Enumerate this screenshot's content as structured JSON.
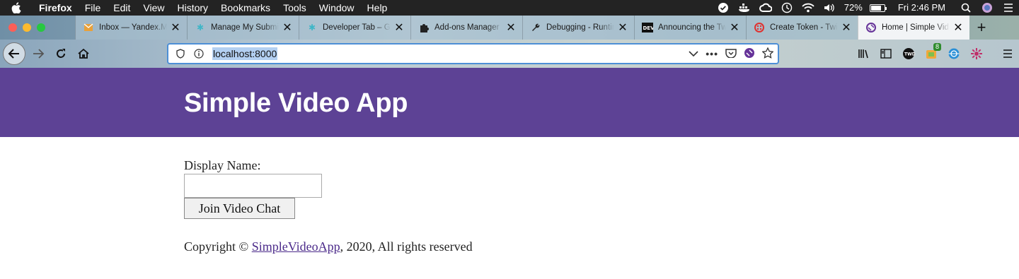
{
  "os_menubar": {
    "app_name": "Firefox",
    "menus": [
      "File",
      "Edit",
      "View",
      "History",
      "Bookmarks",
      "Tools",
      "Window",
      "Help"
    ],
    "battery_percent": "72%",
    "clock": "Fri 2:46 PM"
  },
  "tabs": [
    {
      "title": "Inbox — Yandex.Mail",
      "icon": "mail-icon",
      "color": "#e8a13a"
    },
    {
      "title": "Manage My Submissions",
      "icon": "puzzle-glyph-icon",
      "color": "#3fb6c7"
    },
    {
      "title": "Developer Tab – GitHub",
      "icon": "puzzle-glyph-icon",
      "color": "#3fb6c7"
    },
    {
      "title": "Add-ons Manager",
      "icon": "puzzle-icon",
      "color": "#222222"
    },
    {
      "title": "Debugging - Runtime",
      "icon": "wrench-icon",
      "color": "#222222"
    },
    {
      "title": "Announcing the Twilio",
      "icon": "dev-icon",
      "color": "#111111"
    },
    {
      "title": "Create Token - Twilio",
      "icon": "twilio-icon",
      "color": "#e0312f"
    },
    {
      "title": "Home | Simple Video App",
      "icon": "gatsby-icon",
      "color": "#663399",
      "active": true
    }
  ],
  "navbar": {
    "url": "localhost:8000"
  },
  "extensions": {
    "badge_count": "8"
  },
  "page": {
    "app_title": "Simple Video App",
    "display_name_label": "Display Name:",
    "display_name_value": "",
    "join_button": "Join Video Chat",
    "footer_prefix": "Copyright © ",
    "footer_link": "SimpleVideoApp",
    "footer_suffix": ", 2020, All rights reserved"
  },
  "colors": {
    "header_bg": "#5d4295",
    "link": "#4b2a8a",
    "url_focus": "#4d8fd6"
  }
}
